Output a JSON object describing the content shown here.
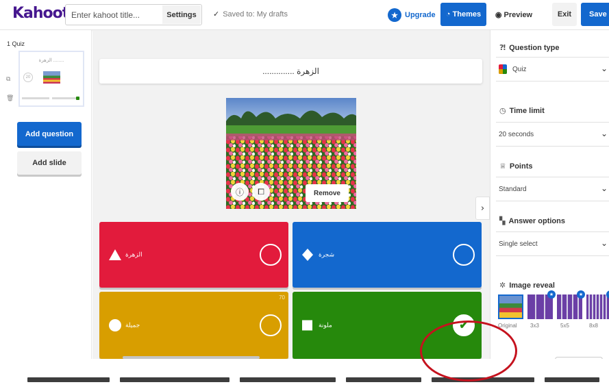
{
  "header": {
    "logo_text": "Kahoot!",
    "title_placeholder": "Enter kahoot title...",
    "settings_label": "Settings",
    "saved_status": "Saved to: My drafts",
    "upgrade_label": "Upgrade",
    "themes_label": "Themes",
    "preview_label": "Preview",
    "exit_label": "Exit",
    "save_label": "Save"
  },
  "sidebar": {
    "slide_label": "1  Quiz",
    "thumb_title": "الزهرة ........",
    "thumb_number": "20",
    "add_question_label": "Add question",
    "add_slide_label": "Add slide"
  },
  "editor": {
    "question_text": "الزهرة ..............",
    "remove_label": "Remove",
    "answers": [
      {
        "text": "الزهرة",
        "shape": "triangle",
        "color": "#e21b3c",
        "correct": false
      },
      {
        "text": "شجرة",
        "shape": "diamond",
        "color": "#1368ce",
        "correct": false
      },
      {
        "text": "جميلة",
        "shape": "circle",
        "color": "#d89e00",
        "correct": false,
        "char_count": "70"
      },
      {
        "text": "ملونة",
        "shape": "square",
        "color": "#26890c",
        "correct": true
      }
    ]
  },
  "right_panel": {
    "question_type_title": "Question type",
    "question_type_value": "Quiz",
    "time_limit_title": "Time limit",
    "time_limit_value": "20 seconds",
    "points_title": "Points",
    "points_value": "Standard",
    "answer_options_title": "Answer options",
    "answer_options_value": "Single select",
    "image_reveal_title": "Image reveal",
    "image_reveal_options": [
      "Original",
      "3x3",
      "5x5",
      "8x8"
    ]
  },
  "icons": {
    "upgrade": "star-icon",
    "themes": "palette-icon",
    "preview": "eye-icon",
    "question_type": "question-icon",
    "time_limit": "clock-icon",
    "points": "medal-icon",
    "answer_options": "grid-icon",
    "image_reveal": "sparkle-icon"
  },
  "colors": {
    "brand": "#46178f",
    "primary": "#1368ce",
    "red": "#e21b3c",
    "blue": "#1368ce",
    "yellow": "#d89e00",
    "green": "#26890c",
    "annotation": "#c5121e"
  }
}
